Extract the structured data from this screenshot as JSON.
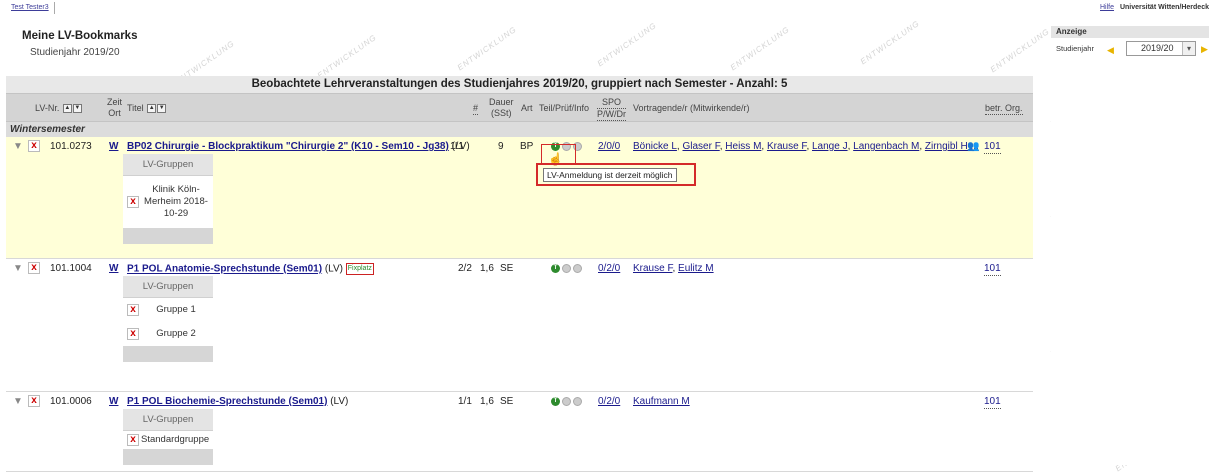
{
  "user": {
    "name": "Test Tester3"
  },
  "top_links": {
    "help": "Hilfe",
    "university": "Universität Witten/Herdeck"
  },
  "header": {
    "title": "Meine LV-Bookmarks",
    "subtitle": "Studienjahr 2019/20"
  },
  "panel": {
    "heading": "Anzeige",
    "year_label": "Studienjahr",
    "year_value": "2019/20"
  },
  "watermark": "ENTWICKLUNG",
  "table": {
    "title": "Beobachtete Lehrveranstaltungen des Studienjahres 2019/20, gruppiert nach Semester - Anzahl: 5",
    "columns": {
      "lvnr": "LV-Nr.",
      "zeit": "Zeit",
      "ort": "Ort",
      "titel": "Titel",
      "hash": "#",
      "dauer": "Dauer",
      "sst": "(SSt)",
      "art": "Art",
      "teil": "Teil/Prüf/Info",
      "spo": "SPO",
      "pwdr": "P/W/Dr",
      "vortragende": "Vortragende/r (Mitwirkende/r)",
      "org": "betr. Org."
    },
    "group": "Wintersemester",
    "courses": [
      {
        "nr": "101.0273",
        "w": "W",
        "title": "BP02 Chirurgie - Blockpraktikum \"Chirurgie 2\" (K10 - Sem10 - Jg38)",
        "suffix": "(LV)",
        "count": "1/1",
        "dauer": "9",
        "art": "BP",
        "spo": "2/0/0",
        "lecturers": [
          "Bönicke L",
          "Glaser F",
          "Heiss M",
          "Krause F",
          "Lange J",
          "Langenbach M",
          "Zirngibl H ..."
        ],
        "org": "101",
        "groups_header": "LV-Gruppen",
        "groups": [
          "Klinik Köln-Merheim 2018-10-29"
        ]
      },
      {
        "nr": "101.1004",
        "w": "W",
        "title": "P1 POL Anatomie-Sprechstunde (Sem01)",
        "suffix": "(LV)",
        "badge": "Fixplatz",
        "count": "2/2",
        "dauer": "1,6",
        "art": "SE",
        "spo": "0/2/0",
        "lecturers": [
          "Krause F",
          "Eulitz M"
        ],
        "org": "101",
        "groups_header": "LV-Gruppen",
        "groups": [
          "Gruppe 1",
          "Gruppe 2"
        ]
      },
      {
        "nr": "101.0006",
        "w": "W",
        "title": "P1 POL Biochemie-Sprechstunde (Sem01)",
        "suffix": "(LV)",
        "count": "1/1",
        "dauer": "1,6",
        "art": "SE",
        "spo": "0/2/0",
        "lecturers": [
          "Kaufmann M"
        ],
        "org": "101",
        "groups_header": "LV-Gruppen",
        "groups": [
          "Standardgruppe"
        ]
      }
    ]
  },
  "tooltip": "LV-Anmeldung ist derzeit möglich",
  "icons": {
    "chevron": "chevron-down-icon",
    "delete": "delete-icon",
    "registration": "registration-status-icon",
    "org": "people-icon",
    "cursor": "hand-pointer-icon"
  },
  "colors": {
    "link": "#1a1a8c",
    "delete": "#cc0000",
    "highlight": "#ffffd8",
    "alert_border": "#d42a2a"
  }
}
